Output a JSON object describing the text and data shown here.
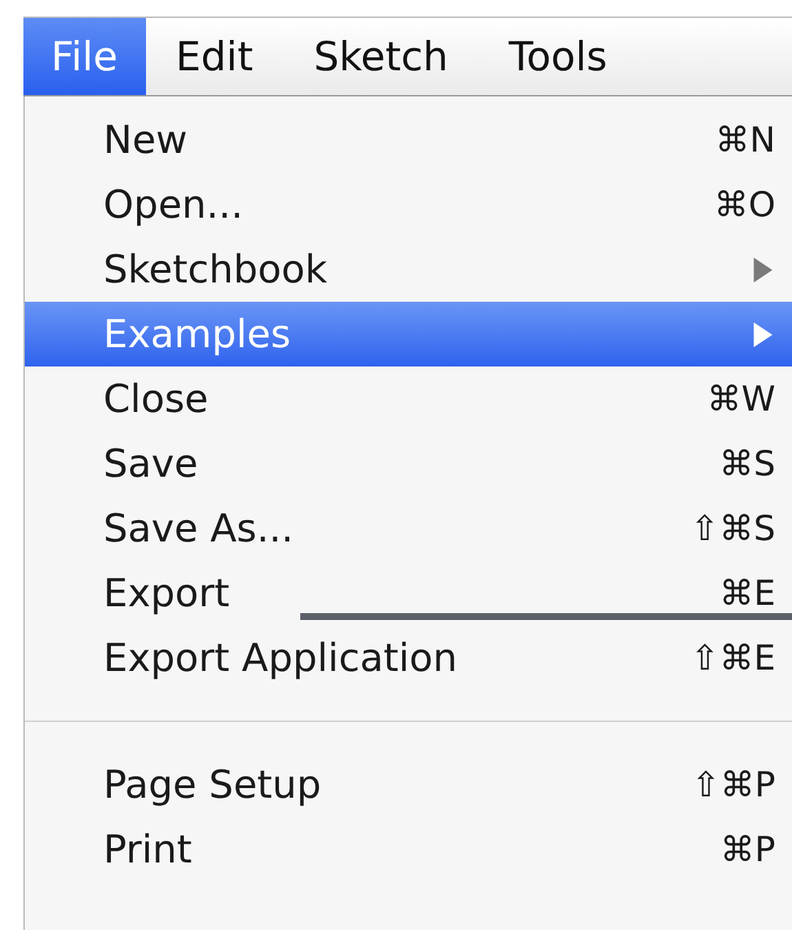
{
  "menu_bar": [
    {
      "label": "File",
      "selected": true
    },
    {
      "label": "Edit",
      "selected": false
    },
    {
      "label": "Sketch",
      "selected": false
    },
    {
      "label": "Tools",
      "selected": false
    }
  ],
  "menu": {
    "items": [
      {
        "kind": "item",
        "label": "New",
        "shortcut": "⌘N",
        "selected": false
      },
      {
        "kind": "item",
        "label": "Open...",
        "shortcut": "⌘O",
        "selected": false
      },
      {
        "kind": "submenu",
        "label": "Sketchbook",
        "selected": false
      },
      {
        "kind": "submenu",
        "label": "Examples",
        "selected": true
      },
      {
        "kind": "item",
        "label": "Close",
        "shortcut": "⌘W",
        "selected": false
      },
      {
        "kind": "item",
        "label": "Save",
        "shortcut": "⌘S",
        "selected": false
      },
      {
        "kind": "item",
        "label": "Save As...",
        "shortcut": "⇧⌘S",
        "selected": false
      },
      {
        "kind": "item",
        "label": "Export",
        "shortcut": "⌘E",
        "selected": false,
        "pointer": true
      },
      {
        "kind": "item",
        "label": "Export Application",
        "shortcut": "⇧⌘E",
        "selected": false
      },
      {
        "kind": "separator"
      },
      {
        "kind": "item",
        "label": "Page Setup",
        "shortcut": "⇧⌘P",
        "selected": false
      },
      {
        "kind": "item",
        "label": "Print",
        "shortcut": "⌘P",
        "selected": false
      }
    ]
  }
}
